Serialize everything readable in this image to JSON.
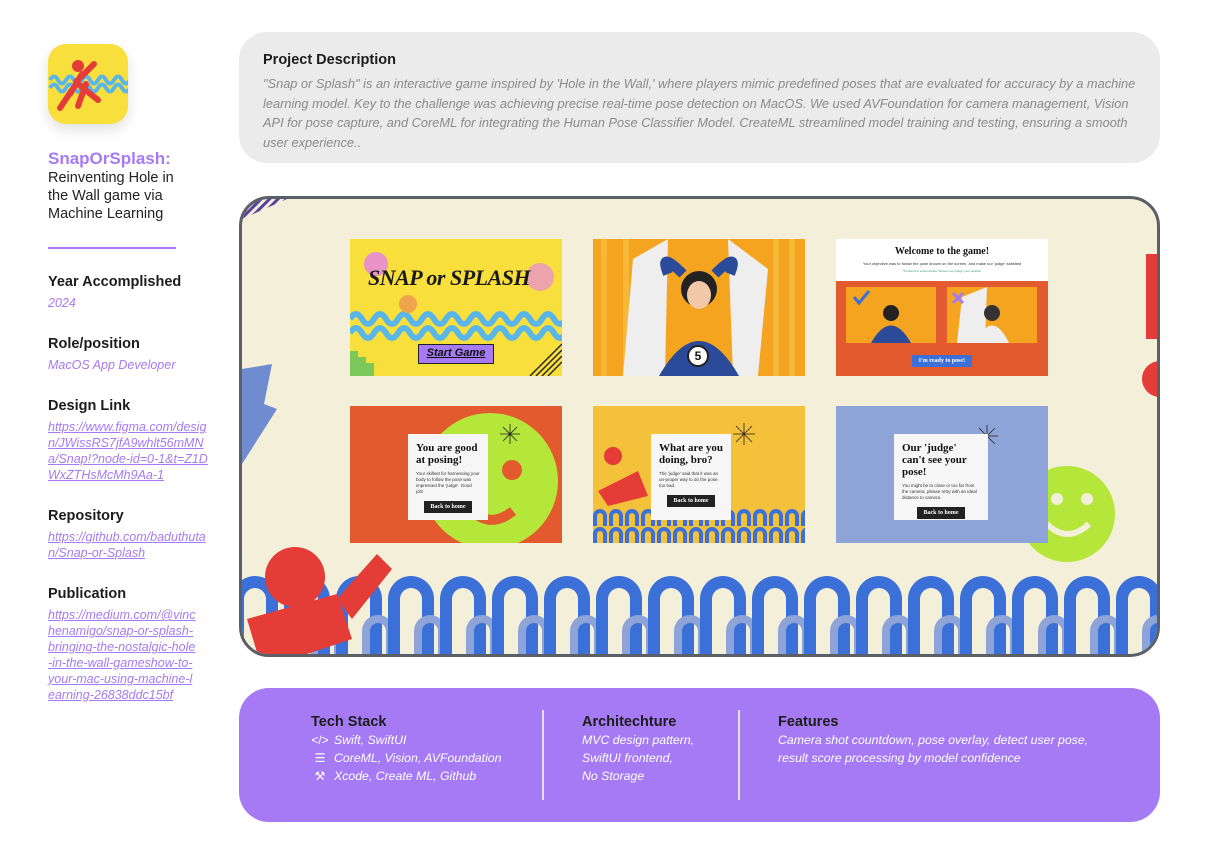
{
  "sidebar": {
    "title": "SnapOrSplash:",
    "subtitle": "Reinventing Hole in the Wall game via Machine Learning",
    "year_label": "Year Accomplished",
    "year_value": "2024",
    "role_label": "Role/position",
    "role_value": "MacOS App Developer",
    "design_label": "Design Link",
    "design_value": "https://www.figma.com/design/JWissRS7jfA9whlt56mMNa/Snap!?node-id=0-1&t=Z1DWxZTHsMcMh9Aa-1",
    "repo_label": "Repository",
    "repo_value": "https://github.com/baduthutan/Snap-or-Splash",
    "publication_label": "Publication",
    "publication_value": "https://medium.com/@vinchenamigo/snap-or-splash-bringing-the-nostalgic-hole-in-the-wall-gameshow-to-your-mac-using-machine-learning-26838ddc15bf"
  },
  "description": {
    "title": "Project Description",
    "text": "\"Snap or Splash\" is an interactive game inspired by 'Hole in the Wall,' where players mimic predefined poses that are evaluated for accuracy by a machine learning model. Key to the challenge was achieving precise real-time pose detection on MacOS. We used AVFoundation for camera management, Vision API for pose capture, and CoreML for integrating the Human Pose Classifier Model. CreateML streamlined model training and testing, ensuring a smooth user experience.."
  },
  "screens": {
    "start": {
      "logo_text": "SNAP or SPLASH",
      "button": "Start Game"
    },
    "countdown": {
      "number": "5"
    },
    "welcome": {
      "title": "Welcome to the game!",
      "text": "Your objective was to follow the pose shown on the screen, and make our 'judge' satisfied",
      "note": "*Portrait the screen below *Ensure our 'judge' your position",
      "button": "I'm ready to pose!"
    },
    "good": {
      "title": "You are good at posing!",
      "text": "Your skillset for harnessing your body to follow the pose was impressed the 'judge'. Good job!",
      "button": "Back to home"
    },
    "bad": {
      "title": "What are you doing, bro?",
      "text": "The 'judge' said that it was an un-proper way to do the pose. too bad.",
      "button": "Back to home"
    },
    "nosee": {
      "title": "Our 'judge' can't see your pose!",
      "text": "You might be to close or too far from the camera, please retry with an ideal distance to camera.",
      "button": "Back to home"
    }
  },
  "info": {
    "tech_title": "Tech Stack",
    "tech_items": [
      {
        "icon": "code-icon",
        "text": "Swift, SwiftUI"
      },
      {
        "icon": "layers-icon",
        "text": "CoreML, Vision, AVFoundation"
      },
      {
        "icon": "hammer-icon",
        "text": "Xcode, Create ML, Github"
      }
    ],
    "arch_title": "Architechture",
    "arch_items": [
      "MVC design pattern,",
      "SwiftUI frontend,",
      "No Storage"
    ],
    "feat_title": "Features",
    "feat_items": [
      "Camera shot countdown, pose overlay, detect user pose,",
      "result score processing by model confidence"
    ]
  },
  "colors": {
    "accent": "#a57af4",
    "yellow": "#f8df3b",
    "orange": "#e45a2f",
    "blue": "#3a70d8",
    "red": "#e43c37",
    "lime": "#b5e63a"
  }
}
